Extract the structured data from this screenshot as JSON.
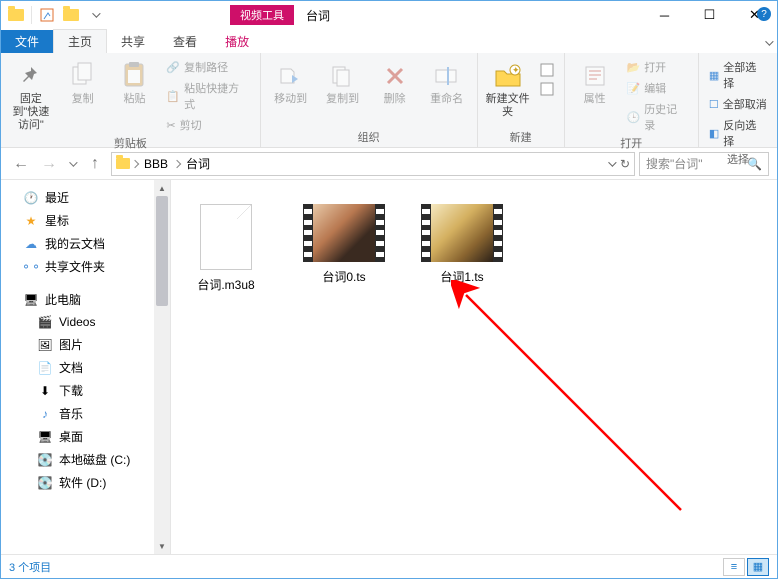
{
  "titlebar": {
    "tool_category": "视频工具",
    "window_title": "台词"
  },
  "tabs": {
    "file": "文件",
    "home": "主页",
    "share": "共享",
    "view": "查看",
    "play": "播放"
  },
  "ribbon": {
    "clipboard": {
      "pin": "固定到\"快速访问\"",
      "copy": "复制",
      "paste": "粘贴",
      "copy_path": "复制路径",
      "paste_shortcut": "粘贴快捷方式",
      "cut": "剪切",
      "group": "剪贴板"
    },
    "organize": {
      "move_to": "移动到",
      "copy_to": "复制到",
      "delete": "删除",
      "rename": "重命名",
      "group": "组织"
    },
    "new": {
      "new_folder": "新建文件夹",
      "group": "新建"
    },
    "open": {
      "properties": "属性",
      "open": "打开",
      "edit": "编辑",
      "history": "历史记录",
      "group": "打开"
    },
    "select": {
      "select_all": "全部选择",
      "select_none": "全部取消",
      "invert": "反向选择",
      "group": "选择"
    }
  },
  "breadcrumb": {
    "items": [
      "BBB",
      "台词"
    ]
  },
  "search": {
    "placeholder": "搜索\"台词\""
  },
  "tree": {
    "recent": "最近",
    "starred": "星标",
    "cloud_docs": "我的云文档",
    "shared": "共享文件夹",
    "this_pc": "此电脑",
    "videos": "Videos",
    "pictures": "图片",
    "documents": "文档",
    "downloads": "下载",
    "music": "音乐",
    "desktop": "桌面",
    "local_c": "本地磁盘 (C:)",
    "local_d": "软件 (D:)"
  },
  "files": [
    {
      "name": "台词.m3u8",
      "kind": "doc"
    },
    {
      "name": "台词0.ts",
      "kind": "video",
      "bg": "linear-gradient(135deg,#e8c9a8,#b87850 40%,#3a2a20 70%)"
    },
    {
      "name": "台词1.ts",
      "kind": "video",
      "bg": "linear-gradient(135deg,#f5e8c0,#d4b060 40%,#8a6530 70%,#2a2018)"
    }
  ],
  "status": {
    "count": "3 个项目"
  }
}
